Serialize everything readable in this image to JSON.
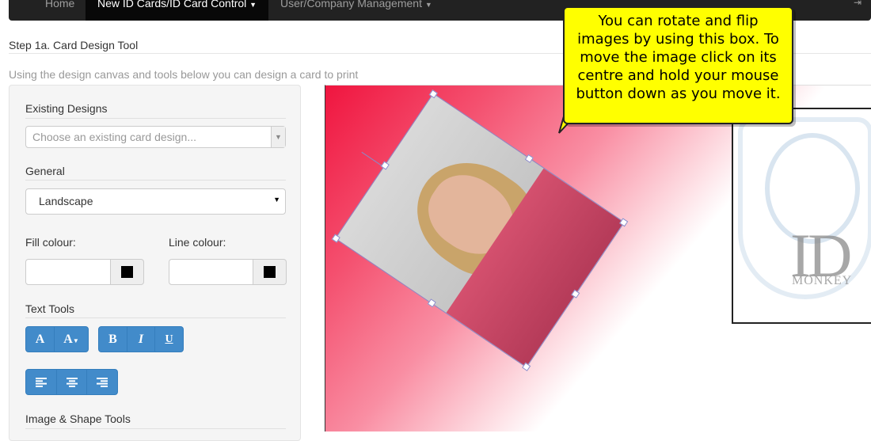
{
  "navbar": {
    "items": [
      {
        "label": "Home"
      },
      {
        "label": "New ID Cards/ID Card Control"
      },
      {
        "label": "User/Company Management"
      }
    ],
    "right_icon": "logout-icon"
  },
  "page": {
    "step_title": "Step 1a. Card Design Tool",
    "intro": "Using the design canvas and tools below you can design a card to print"
  },
  "sidebar": {
    "existing_designs_label": "Existing Designs",
    "existing_designs_placeholder": "Choose an existing card design...",
    "general_label": "General",
    "orientation_value": "Landscape",
    "fill_colour_label": "Fill colour:",
    "line_colour_label": "Line colour:",
    "fill_colour": "#000000",
    "line_colour": "#000000",
    "text_tools_label": "Text Tools",
    "font_size_up": "A",
    "font_size_down": "A",
    "bold": "B",
    "italic": "I",
    "underline": "U",
    "image_shape_tools_label": "Image & Shape Tools"
  },
  "canvas": {
    "logo_text_1": "ID",
    "logo_text_2": "MONKEY"
  },
  "callout": {
    "text": "You can rotate and flip images by using this box. To move the image click on its centre and hold your mouse button down as you move it."
  }
}
